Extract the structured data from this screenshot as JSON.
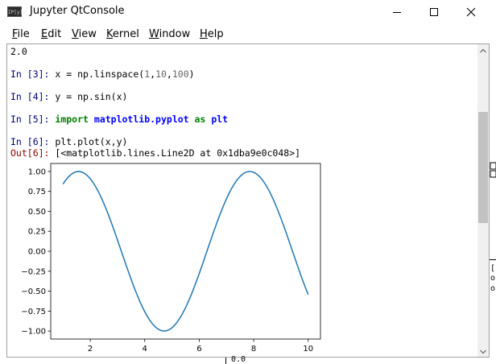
{
  "window": {
    "title": "Jupyter QtConsole",
    "icon": "qtconsole-app-icon",
    "icon_text": "IP[y]:"
  },
  "menu": [
    "File",
    "Edit",
    "View",
    "Kernel",
    "Window",
    "Help"
  ],
  "console": {
    "top_output": "2.0",
    "cells": [
      {
        "prompt": "In [3]:",
        "code": "x = np.linspace(",
        "args": [
          "1",
          "10",
          "100"
        ]
      },
      {
        "prompt": "In [4]:",
        "code": "y = np.sin(x)"
      },
      {
        "prompt": "In [5]:",
        "kw1": "import",
        "module": "matplotlib.pyplot",
        "kw2": "as",
        "alias": "plt"
      },
      {
        "prompt": "In [6]:",
        "code": "plt.plot(x,y)"
      }
    ],
    "out_prompt": "Out[6]:",
    "out_text": "[<matplotlib.lines.Line2D at 0x1dba9e0c048>]"
  },
  "background_fragments": [
    "0.0",
    "[",
    "o",
    "o"
  ],
  "colors": {
    "line": "#1f77b4",
    "in_prompt": "#000080",
    "out_prompt": "#8b0000",
    "keyword": "#008000",
    "name": "#0000ff"
  },
  "chart_data": {
    "type": "line",
    "series": [
      {
        "function": "sin(x)",
        "x_start": 1,
        "x_end": 10,
        "points": 100
      }
    ],
    "x_ticks": [
      2,
      4,
      6,
      8,
      10
    ],
    "y_ticks": [
      1.0,
      0.75,
      0.5,
      0.25,
      0.0,
      -0.25,
      -0.5,
      -0.75,
      -1.0
    ],
    "y_tick_labels": [
      "1.00",
      "0.75",
      "0.50",
      "0.25",
      "0.00",
      "−0.25",
      "−0.50",
      "−0.75",
      "−1.00"
    ],
    "xlim": [
      0.55,
      10.45
    ],
    "ylim": [
      -1.1,
      1.1
    ],
    "grid": false
  }
}
